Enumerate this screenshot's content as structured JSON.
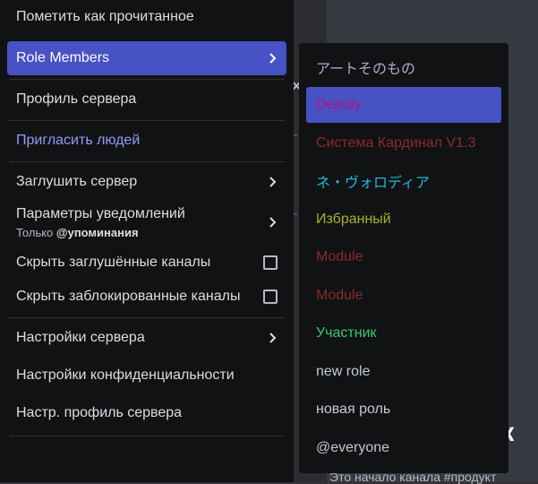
{
  "background": {
    "heading": "ок",
    "subtext": "Это начало канала #продукт",
    "mark": "×"
  },
  "menu": {
    "items": [
      {
        "label": "Пометить как прочитанное"
      },
      {
        "label": "Role Members",
        "active": true,
        "chevron": true
      },
      {
        "label": "Профиль сервера"
      },
      {
        "label": "Пригласить людей"
      },
      {
        "label": "Заглушить сервер",
        "chevron": true
      },
      {
        "label": "Параметры уведомлений",
        "sublabel_prefix": "Только ",
        "sublabel_bold": "@упоминания",
        "chevron": true
      },
      {
        "label": "Скрыть заглушённые каналы",
        "checkbox": false
      },
      {
        "label": "Скрыть заблокированные каналы",
        "checkbox": false
      },
      {
        "label": "Настройки сервера",
        "chevron": true
      },
      {
        "label": "Настройки конфиденциальности"
      },
      {
        "label": "Настр. профиль сервера"
      }
    ]
  },
  "roles": {
    "items": [
      {
        "name": "アートそのもの",
        "color": "#b9a3c9"
      },
      {
        "name": "Deputy",
        "color": "#b0147a",
        "active": true
      },
      {
        "name": "Система Кардинал V1.3",
        "color": "#8a2b2b"
      },
      {
        "name": "ネ・ヴォロディア",
        "color": "#1fb7d8"
      },
      {
        "name": "Избранный",
        "color": "#a8b32a"
      },
      {
        "name": "Module",
        "color": "#8a2b2b"
      },
      {
        "name": "Module",
        "color": "#8a2b2b"
      },
      {
        "name": "Участник",
        "color": "#2fcc71"
      },
      {
        "name": "new role",
        "color": "#c4c9ce"
      },
      {
        "name": "новая роль",
        "color": "#c4c9ce"
      },
      {
        "name": "@everyone",
        "color": "#c4c9ce"
      }
    ]
  },
  "colors": {
    "menu_bg": "#111214",
    "active": "#4752c4",
    "invite": "#949cf7",
    "text": "#dbdee1"
  }
}
